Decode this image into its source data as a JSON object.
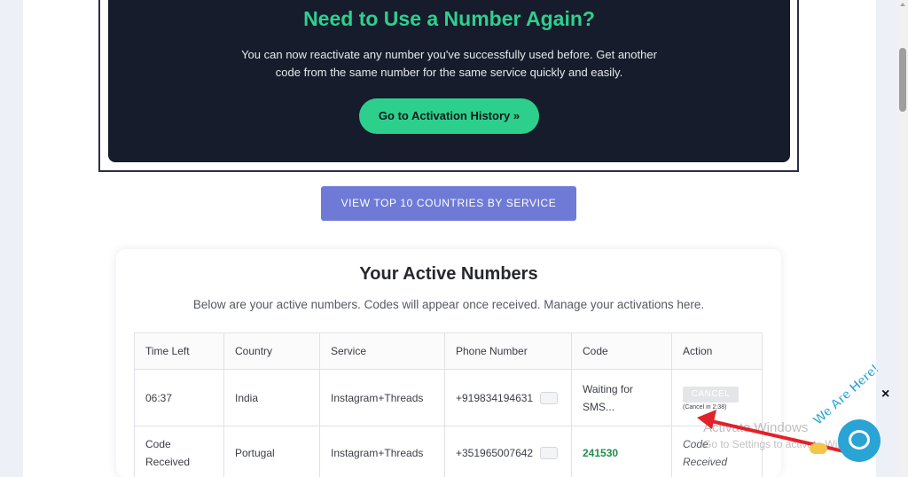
{
  "banner": {
    "title": "Need to Use a Number Again?",
    "text_line1": "You can now reactivate any number you've successfully used before. Get another",
    "text_line2": "code from the same number for the same service quickly and easily.",
    "button_label": "Go to Activation History »"
  },
  "countries_button": "VIEW TOP 10 COUNTRIES BY SERVICE",
  "active_numbers": {
    "title": "Your Active Numbers",
    "subtitle": "Below are your active numbers. Codes will appear once received. Manage your activations here.",
    "columns": [
      "Time Left",
      "Country",
      "Service",
      "Phone Number",
      "Code",
      "Action"
    ],
    "rows": [
      {
        "time_left": "06:37",
        "country": "India",
        "service": "Instagram+Threads",
        "phone": "+919834194631",
        "code_line1": "Waiting for",
        "code_line2": "SMS...",
        "action_button": "CANCEL",
        "action_note": "(Cancel in 2:38)"
      },
      {
        "time_left_line1": "Code",
        "time_left_line2": "Received",
        "country": "Portugal",
        "service": "Instagram+Threads",
        "phone": "+351965007642",
        "code": "241530",
        "action_line1": "Code",
        "action_line2": "Received"
      }
    ]
  },
  "watermark": {
    "title": "Activate Windows",
    "subtitle": "Go to Settings to activate Windows."
  },
  "chat_widget": {
    "label": "We Are Here!",
    "close": "×",
    "icon": "chat-icon"
  },
  "colors": {
    "accent_green": "#2dcf8d",
    "banner_bg": "#161c2b",
    "button_blue": "#6e7ad6",
    "code_green": "#1f8f4a",
    "annotation_red": "#e3212a"
  }
}
